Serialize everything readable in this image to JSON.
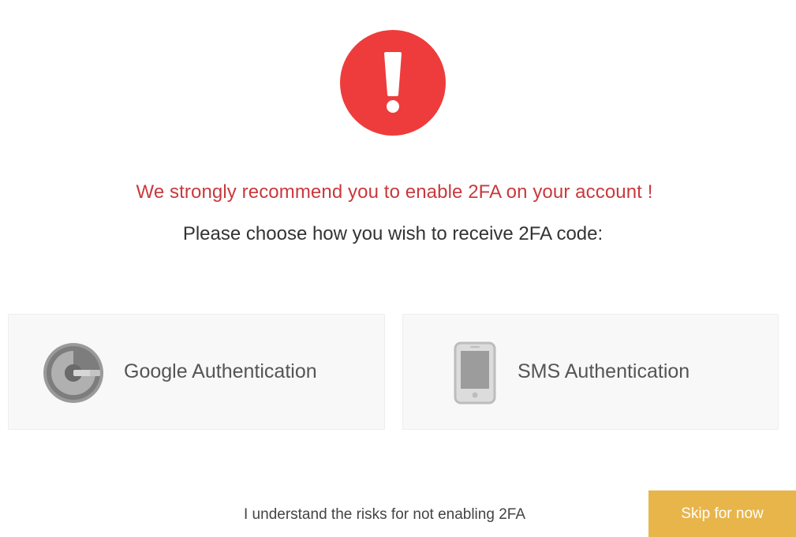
{
  "dialog": {
    "warning_message": "We strongly recommend you to enable 2FA on your account !",
    "instruction": "Please choose how you wish to receive 2FA code:"
  },
  "options": [
    {
      "label": "Google Authentication",
      "icon": "google-authenticator-icon"
    },
    {
      "label": "SMS Authentication",
      "icon": "phone-icon"
    }
  ],
  "footer": {
    "risk_link": "I understand the risks for not enabling 2FA",
    "skip_label": "Skip for now"
  },
  "colors": {
    "alert_red": "#ee3c3c",
    "warning_text": "#c9393d",
    "skip_button": "#e8b54a"
  }
}
